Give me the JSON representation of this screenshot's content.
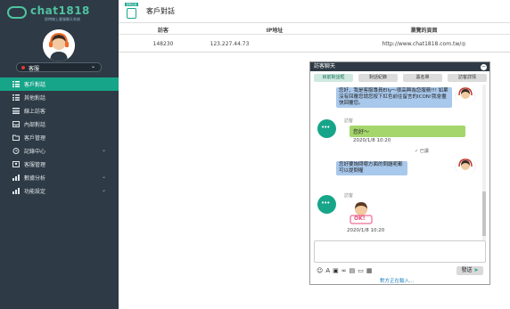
{
  "sidebar": {
    "brand": "chat1818",
    "tagline": "即時線上客服聊天系統",
    "status": "客服",
    "items": [
      {
        "label": "客戶對話",
        "icon": "chat-list-icon"
      },
      {
        "label": "其他對話",
        "icon": "list-icon"
      },
      {
        "label": "線上訪客",
        "icon": "visitor-list-icon"
      },
      {
        "label": "內部對話",
        "icon": "inbox-icon"
      },
      {
        "label": "客戶管理",
        "icon": "folder-icon"
      },
      {
        "label": "記錄中心",
        "icon": "clock-icon"
      },
      {
        "label": "客服管理",
        "icon": "user-manage-icon"
      },
      {
        "label": "數據分析",
        "icon": "bar-chart-icon"
      },
      {
        "label": "功能設定",
        "icon": "settings-icon"
      }
    ]
  },
  "header": {
    "icon_caption": "服務記錄",
    "title": "客戶對話"
  },
  "table": {
    "columns": [
      "訪客",
      "IP地址",
      "瀏覽的頁面"
    ],
    "rows": [
      [
        "148230",
        "123.227.44.73",
        "http://www.chat1818.com.tw/◎"
      ]
    ]
  },
  "chat": {
    "title": "訪客聊天",
    "tabs": [
      "目前對話框",
      "對話紀錄",
      "黑名單",
      "訪客詳情"
    ],
    "messages": [
      {
        "text": "您好，我是客服專員Elly～很高興為您服務!!! 如果沒有回覆您請您按下紅色前往留言的ICON!我會盡快回覆您。"
      },
      {
        "sender": "訪客",
        "text": "您好～",
        "time": "2020/1/8 10:20"
      },
      {
        "read": "已讀"
      },
      {
        "text": "您好要詢問哪方面的問題呢都可以提問喔"
      },
      {
        "sender": "訪客",
        "sticker": "OK!",
        "time": "2020/1/8 10:20"
      }
    ],
    "send_label": "發送",
    "typing": "對方正在輸入..."
  },
  "colors": {
    "sidebar_bg": "#2e3a45",
    "accent": "#17a589",
    "agent_bubble": "#a8c8ec",
    "visitor_bubble": "#a5d66c"
  }
}
